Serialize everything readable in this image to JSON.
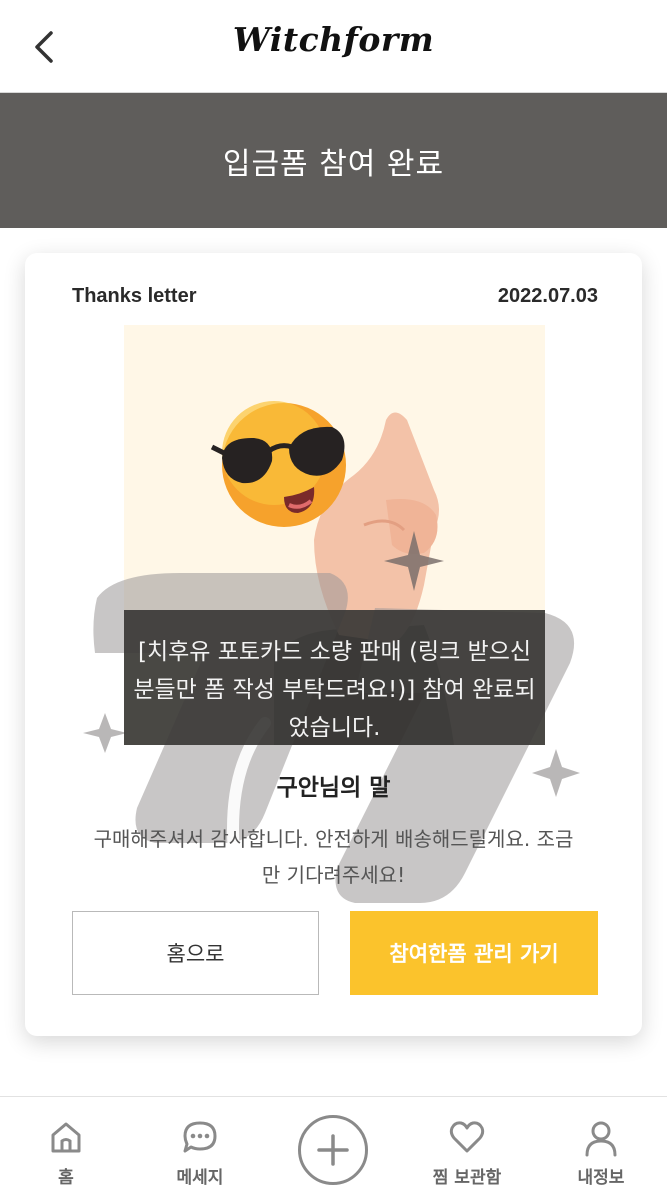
{
  "header": {
    "logo": "Witchform",
    "back_icon": "chevron-left-icon"
  },
  "banner": {
    "title": "입금폼 참여 완료",
    "background": "#5f5d5b"
  },
  "card": {
    "label": "Thanks letter",
    "date": "2022.07.03",
    "toast_message": "[치후유 포토카드 소량 판매 (링크 받으신 분들만 폼 작성 부탁드려요!)] 참여 완료되었습니다.",
    "sender_heading": "구안님의 말",
    "message": "구매해주셔서 감사합니다. 안전하게 배송해드릴게요. 조금만 기다려주세요!",
    "home_button": "홈으로",
    "manage_button": "참여한폼 관리 가기",
    "accent_color": "#fbc32c"
  },
  "bottom_nav": {
    "items": [
      {
        "label": "홈",
        "icon": "home-icon"
      },
      {
        "label": "메세지",
        "icon": "chat-bubble-icon"
      },
      {
        "label": "",
        "icon": "plus-circle-icon"
      },
      {
        "label": "찜 보관함",
        "icon": "heart-icon"
      },
      {
        "label": "내정보",
        "icon": "user-icon"
      }
    ]
  }
}
